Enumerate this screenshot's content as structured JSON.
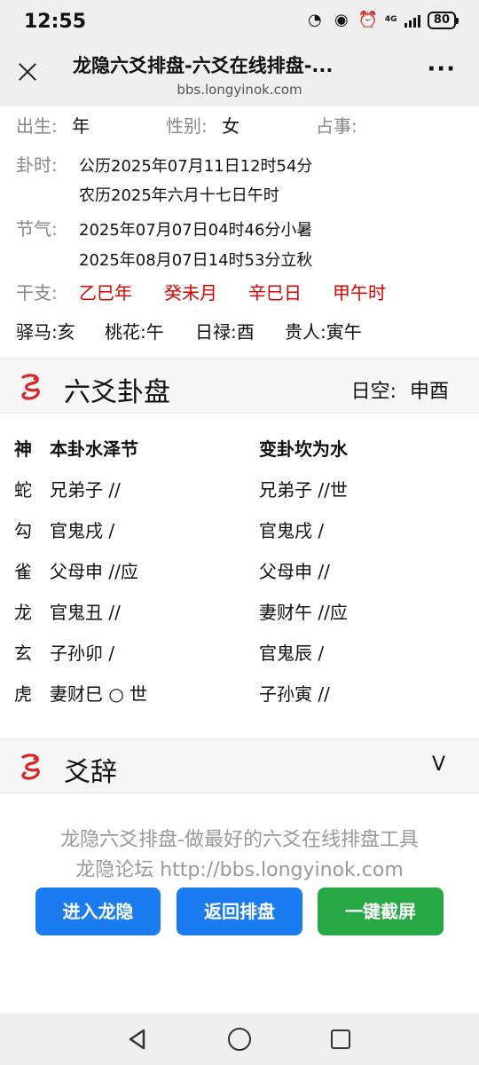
{
  "status": {
    "time": "12:55",
    "net": "4G",
    "battery": "80"
  },
  "titlebar": {
    "title": "龙隐六爻排盘-六爻在线排盘-...",
    "url": "bbs.longyinok.com"
  },
  "info": {
    "birth_label": "出生:",
    "birth_value": "年",
    "gender_label": "性别:",
    "gender_value": "女",
    "matter_label": "占事:",
    "time_label": "卦时:",
    "time_solar": "公历2025年07月11日12时54分",
    "time_lunar": "农历2025年六月十七日午时",
    "jieqi_label": "节气:",
    "jieqi_1": "2025年07月07日04时46分小暑",
    "jieqi_2": "2025年08月07日14时53分立秋",
    "ganzhi_label": "干支:",
    "ganzhi": [
      "乙巳年",
      "癸未月",
      "辛巳日",
      "甲午时"
    ],
    "shensha": [
      "驿马:亥",
      "桃花:午",
      "日禄:酉",
      "贵人:寅午"
    ]
  },
  "liuyao": {
    "title": "六爻卦盘",
    "kong_label": "日空:",
    "kong_value": "申酉",
    "header": {
      "shen": "神",
      "ben": "本卦水泽节",
      "bian": "变卦坎为水"
    },
    "rows": [
      {
        "shen": "蛇",
        "ben": "兄弟子 //",
        "bian": "兄弟子 //世"
      },
      {
        "shen": "勾",
        "ben": "官鬼戌  /",
        "bian": "官鬼戌  /"
      },
      {
        "shen": "雀",
        "ben": "父母申 //应",
        "bian": "父母申 //"
      },
      {
        "shen": "龙",
        "ben": "官鬼丑 //",
        "bian": "妻财午 //应"
      },
      {
        "shen": "玄",
        "ben": "子孙卯  /",
        "bian": "官鬼辰  /"
      },
      {
        "shen": "虎",
        "ben": "妻财巳 ○ 世",
        "bian": "子孙寅 //"
      }
    ]
  },
  "yaoci": {
    "title": "爻辞",
    "toggle": "V"
  },
  "footer": {
    "line1": "龙隐六爻排盘-做最好的六爻在线排盘工具",
    "line2": "龙隐论坛 http://bbs.longyinok.com",
    "btn_enter": "进入龙隐",
    "btn_back": "返回排盘",
    "btn_shot": "一键截屏"
  },
  "colors": {
    "blue": "#1a7cf0",
    "green": "#28a745",
    "red": "#e00000"
  }
}
